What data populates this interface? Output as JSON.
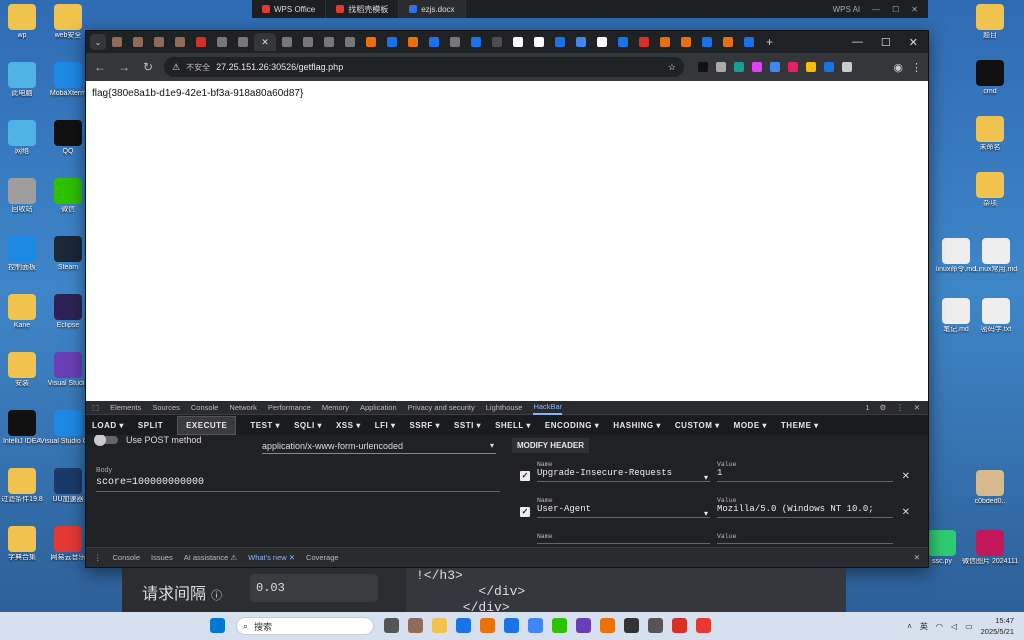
{
  "wps_tabs": [
    {
      "icon_color": "#e53935",
      "label": "WPS Office"
    },
    {
      "icon_color": "#e53935",
      "label": "找稻壳模板"
    },
    {
      "icon_color": "#2f6feb",
      "label": "ezjs.docx",
      "active": true
    }
  ],
  "wps_ai": "WPS AI",
  "desktop_left": [
    {
      "label": "wp",
      "color": "#f0c34e"
    },
    {
      "label": "web安全",
      "color": "#f0c34e"
    },
    {
      "label": "此电脑",
      "color": "#4fb3e8"
    },
    {
      "label": "MobaXterm",
      "color": "#1e88e5"
    },
    {
      "label": "网络",
      "color": "#4fb3e8"
    },
    {
      "label": "QQ",
      "color": "#111111"
    },
    {
      "label": "回收站",
      "color": "#9e9e9e"
    },
    {
      "label": "微信",
      "color": "#2dc100"
    },
    {
      "label": "控制面板",
      "color": "#1e88e5"
    },
    {
      "label": "Steam",
      "color": "#1b2838"
    },
    {
      "label": "Kane",
      "color": "#f0c34e"
    },
    {
      "label": "Eclipse",
      "color": "#2c2255"
    },
    {
      "label": "安装",
      "color": "#f0c34e"
    },
    {
      "label": "Visual Studio",
      "color": "#6a3fb5"
    },
    {
      "label": "IntelliJ IDEA",
      "color": "#111111"
    },
    {
      "label": "Visual Studio Code",
      "color": "#1e88e5"
    },
    {
      "label": "过滤条件19.8",
      "color": "#f0c34e"
    },
    {
      "label": "UU加速器",
      "color": "#1a3a6b"
    },
    {
      "label": "字典合集",
      "color": "#f0c34e"
    },
    {
      "label": "网易云音乐",
      "color": "#e53935"
    }
  ],
  "desktop_right": [
    {
      "label": "题目",
      "color": "#f0c34e"
    },
    {
      "label": "cmd",
      "color": "#111111"
    },
    {
      "label": "未命名",
      "color": "#f0c34e"
    },
    {
      "label": "杂项",
      "color": "#f0c34e"
    },
    {
      "label": "linux命令.md",
      "color": "#eeeeee"
    },
    {
      "label": "Linux常用.md",
      "color": "#eeeeee"
    },
    {
      "label": "笔记.md",
      "color": "#eeeeee"
    },
    {
      "label": "密码学.txt",
      "color": "#eeeeee"
    },
    {
      "label": "c0bded0..",
      "color": "#d7b98e"
    },
    {
      "label": "ssc.py",
      "color": "#2ecc71"
    },
    {
      "label": "微信图片 2024111..",
      "color": "#c2185b"
    }
  ],
  "browser": {
    "favicon_colors": [
      "#8e6b5a",
      "#8e6b5a",
      "#8e6b5a",
      "#8e6b5a",
      "#d93025",
      "#777777",
      "#777777",
      "#777777",
      "#777777",
      "#777777",
      "#777777",
      "#777777",
      "#e8710a",
      "#1a73e8",
      "#e8710a",
      "#1a73e8",
      "#777777",
      "#1a73e8",
      "#4e4e4e",
      "#ffffff",
      "#ffffff",
      "#1a73e8",
      "#4285f4",
      "#ffffff",
      "#1a73e8",
      "#d93025",
      "#e8710a",
      "#e8710a",
      "#1a73e8",
      "#e8710a",
      "#1a73e8"
    ],
    "not_secure": "不安全",
    "url": "27.25.151.26:30526/getflag.php",
    "ext_colors": [
      "#111111",
      "#aaaaaa",
      "#19a094",
      "#e040fb",
      "#4285f4",
      "#e91e63",
      "#fbbc05",
      "#1a73e8",
      "#cccccc"
    ],
    "page_text": "flag{380e8a1b-d1e9-42e1-bf3a-918a80a60d87}"
  },
  "devtools": {
    "tabs": [
      "Elements",
      "Sources",
      "Console",
      "Network",
      "Performance",
      "Memory",
      "Application",
      "Privacy and security",
      "Lighthouse",
      "HackBar"
    ],
    "active_tab": "HackBar",
    "issue_count": "1",
    "hackbar_menu": [
      "LOAD ▾",
      "SPLIT",
      "EXECUTE",
      "TEST ▾",
      "SQLI ▾",
      "XSS ▾",
      "LFI ▾",
      "SSRF ▾",
      "SSTI ▾",
      "SHELL ▾",
      "ENCODING ▾",
      "HASHING ▾",
      "CUSTOM ▾",
      "MODE ▾",
      "THEME ▾"
    ],
    "post_label": "Use POST method",
    "content_type": "application/x-www-form-urlencoded",
    "modify_header": "MODIFY HEADER",
    "body_label": "Body",
    "body_value": "score=100000000000",
    "name_label": "Name",
    "value_label": "Value",
    "headers": [
      {
        "name": "Upgrade-Insecure-Requests",
        "value": "1"
      },
      {
        "name": "User-Agent",
        "value": "Mozilla/5.0 (Windows NT 10.0;"
      },
      {
        "name": "",
        "value": ""
      }
    ],
    "drawer_tabs": [
      "Console",
      "Issues",
      "AI assistance ⚠",
      "What's new ✕",
      "Coverage"
    ],
    "drawer_active": "What's new ✕"
  },
  "behind_window": {
    "label": "请求间隔",
    "value": "0.03",
    "code_lines": [
      "!</h3>",
      "        </div>",
      "      </div>"
    ]
  },
  "taskbar": {
    "search_placeholder": "搜索",
    "app_colors": [
      "#0078d4",
      "#555555",
      "#8e6b5a",
      "#f0c34e",
      "#1a73e8",
      "#e8710a",
      "#1a73e8",
      "#4285f4",
      "#2dc100",
      "#6a3fb5",
      "#e8710a",
      "#333333",
      "#555555",
      "#d93025",
      "#e53935"
    ],
    "tray_lang": "英",
    "time": "15:47",
    "date": "2025/5/21"
  }
}
